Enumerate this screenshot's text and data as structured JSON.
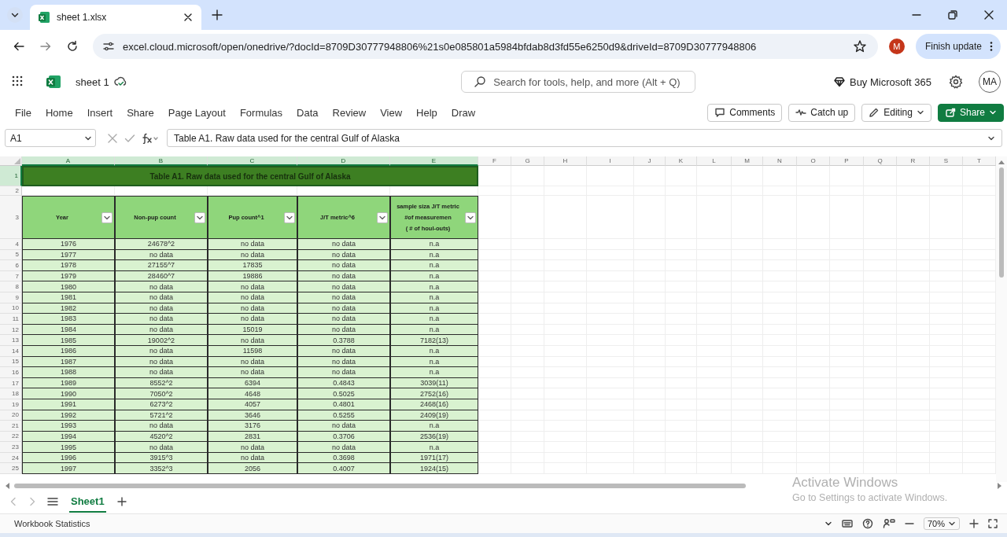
{
  "browser": {
    "tabs": [
      {
        "title": "sheet 1.xlsx",
        "selected": true
      }
    ],
    "url": "excel.cloud.microsoft/open/onedrive/?docId=8709D30777948806%21s0e085801a5984bfdab8d3fd55e6250d9&driveId=8709D30777948806",
    "profile_initial": "M",
    "update_button": "Finish update"
  },
  "app": {
    "file_name": "sheet 1",
    "search": {
      "placeholder": "Search for tools, help, and more (Alt + Q)"
    },
    "buy_label": "Buy Microsoft 365",
    "avatar": "MA"
  },
  "ribbon": {
    "tabs": [
      "File",
      "Home",
      "Insert",
      "Share",
      "Page Layout",
      "Formulas",
      "Data",
      "Review",
      "View",
      "Help",
      "Draw"
    ],
    "buttons": [
      {
        "label": "Comments",
        "kind": "comments"
      },
      {
        "label": "Catch up",
        "kind": "catchup"
      },
      {
        "label": "Editing",
        "kind": "editing"
      },
      {
        "label": "Share",
        "kind": "share"
      }
    ]
  },
  "formula_bar": {
    "name_box": "A1",
    "formula": "Table A1. Raw data used for the central Gulf of Alaska"
  },
  "sheet": {
    "columns": [
      {
        "label": "A",
        "selected": true
      },
      {
        "label": "B",
        "selected": true
      },
      {
        "label": "C",
        "selected": true
      },
      {
        "label": "D",
        "selected": true
      },
      {
        "label": "E",
        "selected": true
      },
      {
        "label": "F",
        "selected": false
      },
      {
        "label": "G",
        "selected": false
      },
      {
        "label": "H",
        "selected": false
      },
      {
        "label": "I",
        "selected": false
      },
      {
        "label": "J",
        "selected": false
      },
      {
        "label": "K",
        "selected": false
      },
      {
        "label": "L",
        "selected": false
      },
      {
        "label": "M",
        "selected": false
      },
      {
        "label": "N",
        "selected": false
      },
      {
        "label": "O",
        "selected": false
      },
      {
        "label": "P",
        "selected": false
      },
      {
        "label": "Q",
        "selected": false
      },
      {
        "label": "R",
        "selected": false
      },
      {
        "label": "S",
        "selected": false
      },
      {
        "label": "T",
        "selected": false
      }
    ],
    "title_row": {
      "row": "1",
      "selected": true,
      "text": "Table A1. Raw data used for the central Gulf of Alaska"
    },
    "blank_row": {
      "row": "2",
      "selected": false
    },
    "header_row": {
      "row": "3",
      "selected": false,
      "cells": [
        {
          "lines": [
            "Year"
          ]
        },
        {
          "lines": [
            "Non-pup count"
          ]
        },
        {
          "lines": [
            "Pup count^1"
          ]
        },
        {
          "lines": [
            "J/T metric^6"
          ]
        },
        {
          "lines": [
            "sample siza J/T metric",
            "#of measuremen",
            "( # of houl-outs)"
          ]
        }
      ]
    },
    "rows": [
      {
        "row": "4",
        "selected": false,
        "cells": [
          "1976",
          "24678^2",
          "no data",
          "no data",
          "n.a"
        ]
      },
      {
        "row": "5",
        "selected": false,
        "cells": [
          "1977",
          "no data",
          "no data",
          "no data",
          "n.a"
        ]
      },
      {
        "row": "6",
        "selected": false,
        "cells": [
          "1978",
          "27155^7",
          "17835",
          "no data",
          "n.a"
        ]
      },
      {
        "row": "7",
        "selected": false,
        "cells": [
          "1979",
          "28460^7",
          "19886",
          "no data",
          "n.a"
        ]
      },
      {
        "row": "8",
        "selected": false,
        "cells": [
          "1980",
          "no data",
          "no data",
          "no data",
          "n.a"
        ]
      },
      {
        "row": "9",
        "selected": false,
        "cells": [
          "1981",
          "no data",
          "no data",
          "no data",
          "n.a"
        ]
      },
      {
        "row": "10",
        "selected": false,
        "cells": [
          "1982",
          "no data",
          "no data",
          "no data",
          "n.a"
        ]
      },
      {
        "row": "11",
        "selected": false,
        "cells": [
          "1983",
          "no data",
          "no data",
          "no data",
          "n.a"
        ]
      },
      {
        "row": "12",
        "selected": false,
        "cells": [
          "1984",
          "no data",
          "15019",
          "no data",
          "n.a"
        ]
      },
      {
        "row": "13",
        "selected": false,
        "cells": [
          "1985",
          "19002^2",
          "no data",
          "0.3788",
          "7182(13)"
        ]
      },
      {
        "row": "14",
        "selected": false,
        "cells": [
          "1986",
          "no data",
          "11598",
          "no data",
          "n.a"
        ]
      },
      {
        "row": "15",
        "selected": false,
        "cells": [
          "1987",
          "no data",
          "no data",
          "no data",
          "n.a"
        ]
      },
      {
        "row": "16",
        "selected": false,
        "cells": [
          "1988",
          "no data",
          "no data",
          "no data",
          "n.a"
        ]
      },
      {
        "row": "17",
        "selected": false,
        "cells": [
          "1989",
          "8552^2",
          "6394",
          "0.4843",
          "3039(11)"
        ]
      },
      {
        "row": "18",
        "selected": false,
        "cells": [
          "1990",
          "7050^2",
          "4648",
          "0.5025",
          "2752(16)"
        ]
      },
      {
        "row": "19",
        "selected": false,
        "cells": [
          "1991",
          "6273^2",
          "4057",
          "0.4801",
          "2468(16)"
        ]
      },
      {
        "row": "20",
        "selected": false,
        "cells": [
          "1992",
          "5721^2",
          "3646",
          "0.5255",
          "2409(19)"
        ]
      },
      {
        "row": "21",
        "selected": false,
        "cells": [
          "1993",
          "no data",
          "3176",
          "no data",
          "n.a"
        ]
      },
      {
        "row": "22",
        "selected": false,
        "cells": [
          "1994",
          "4520^2",
          "2831",
          "0.3706",
          "2536(19)"
        ]
      },
      {
        "row": "23",
        "selected": false,
        "cells": [
          "1995",
          "no data",
          "no data",
          "no data",
          "n.a"
        ]
      },
      {
        "row": "24",
        "selected": false,
        "cells": [
          "1996",
          "3915^3",
          "no data",
          "0.3698",
          "1971(17)"
        ]
      },
      {
        "row": "25",
        "selected": false,
        "cells": [
          "1997",
          "3352^3",
          "2056",
          "0.4007",
          "1924(15)"
        ]
      }
    ]
  },
  "sheet_tabs": [
    {
      "label": "Sheet1",
      "selected": true
    }
  ],
  "status_bar": {
    "label": "Workbook Statistics",
    "zoom": "70%"
  },
  "activation_notice": {
    "title": "Activate Windows",
    "text": "Go to Settings to activate Windows."
  }
}
